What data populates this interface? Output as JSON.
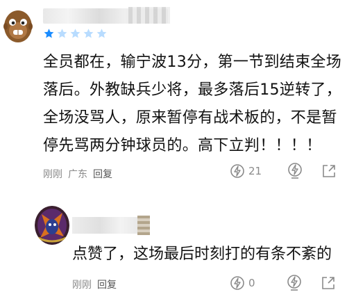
{
  "comment": {
    "rating": 1,
    "rating_max": 5,
    "text_lines": [
      "全员都在，输宁波13分，第一节到结束全场",
      "落后。外教缺兵少将，最多落后15逆转了，",
      "全场没骂人，原来暂停有战术板的，不是暂",
      "停先骂两分钟球员的。高下立判！！！！"
    ],
    "time": "刚刚",
    "location": "广东",
    "reply_label": "回复",
    "like_count": "21"
  },
  "reply": {
    "text": "点赞了，这场最后时刻打的有条不紊的",
    "time": "刚刚",
    "reply_label": "回复",
    "like_count": "0"
  },
  "colors": {
    "star_active": "#1a8cff",
    "star_inactive": "#b8dcff",
    "meta_gray": "#8a8a8a"
  }
}
